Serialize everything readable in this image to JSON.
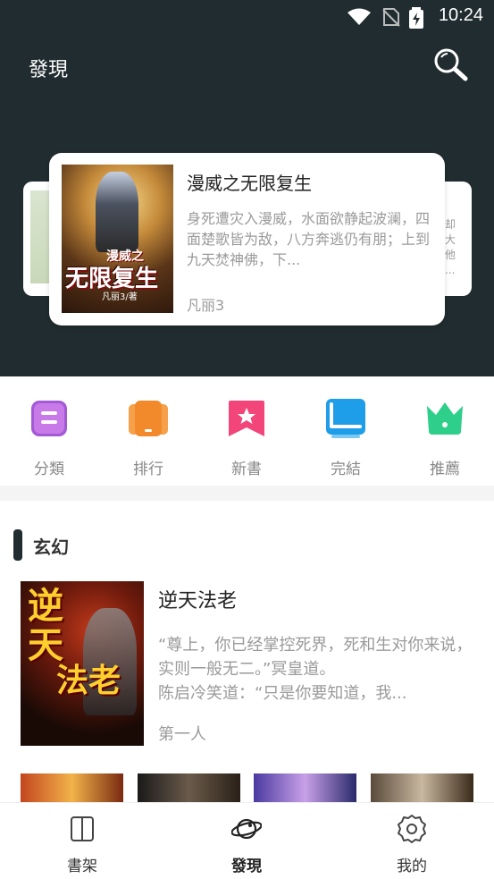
{
  "status_bar": {
    "time": "10:24"
  },
  "header": {
    "title": "發現"
  },
  "featured": {
    "title": "漫威之无限复生",
    "description": "身死遭灾入漫威，水面欲静起波澜，四面楚歌皆为敌，八方奔逃仍有朋；上到九天焚神佛，下...",
    "author": "凡丽3",
    "cover_title": "无限复生",
    "cover_subtitle": "漫威之",
    "cover_author": "凡丽3/著",
    "side_right_text": "却\n大他\n..."
  },
  "categories": [
    {
      "label": "分類",
      "icon": "category-icon",
      "color": "#a45ad6"
    },
    {
      "label": "排行",
      "icon": "ranking-icon",
      "color": "#f28a2c"
    },
    {
      "label": "新書",
      "icon": "new-book-icon",
      "color": "#f2457a"
    },
    {
      "label": "完結",
      "icon": "completed-icon",
      "color": "#1e9de8"
    },
    {
      "label": "推薦",
      "icon": "recommend-crown-icon",
      "color": "#2ecf8a"
    }
  ],
  "section": {
    "title": "玄幻",
    "book": {
      "title": "逆天法老",
      "description": "    “尊上，你已经掌控死界，死和生对你来说，实则一般无二。”冥皇道。\n    陈启冷笑道：“只是你要知道，我...",
      "author": "第一人",
      "cover_text_top": "逆天",
      "cover_text_bottom": "法老"
    }
  },
  "bottom_nav": [
    {
      "label": "書架",
      "icon": "bookshelf-icon"
    },
    {
      "label": "發現",
      "icon": "planet-icon",
      "active": true
    },
    {
      "label": "我的",
      "icon": "settings-gear-icon"
    }
  ],
  "colors": {
    "header_bg": "#202c2f",
    "accent": "#202c2f"
  }
}
